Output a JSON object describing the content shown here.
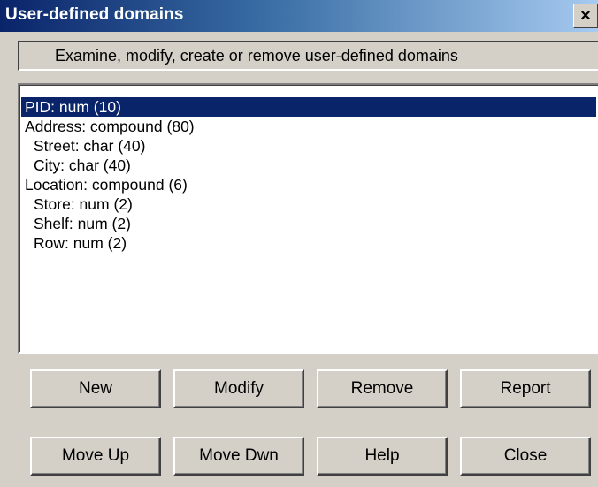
{
  "window": {
    "title": "User-defined domains",
    "close_glyph": "×"
  },
  "subtitle": "Examine, modify, create or remove user-defined domains",
  "domains": [
    {
      "label": "PID: num (10)",
      "selected": true
    },
    {
      "label": "Address: compound (80)",
      "selected": false
    },
    {
      "label": "Street: char (40)",
      "selected": false
    },
    {
      "label": "City: char (40)",
      "selected": false
    },
    {
      "label": "Location: compound (6)",
      "selected": false
    },
    {
      "label": "Store: num (2)",
      "selected": false
    },
    {
      "label": "Shelf: num (2)",
      "selected": false
    },
    {
      "label": "Row: num (2)",
      "selected": false
    }
  ],
  "buttons": {
    "new": "New",
    "modify": "Modify",
    "remove": "Remove",
    "report": "Report",
    "move_up": "Move Up",
    "move_down": "Move Dwn",
    "help": "Help",
    "close": "Close"
  },
  "colors": {
    "title_bar_start": "#0a246a",
    "title_bar_end": "#a6caf0",
    "selection": "#0a246a",
    "dialog_face": "#d4d0c8"
  },
  "icons": {
    "close": "close-icon"
  }
}
